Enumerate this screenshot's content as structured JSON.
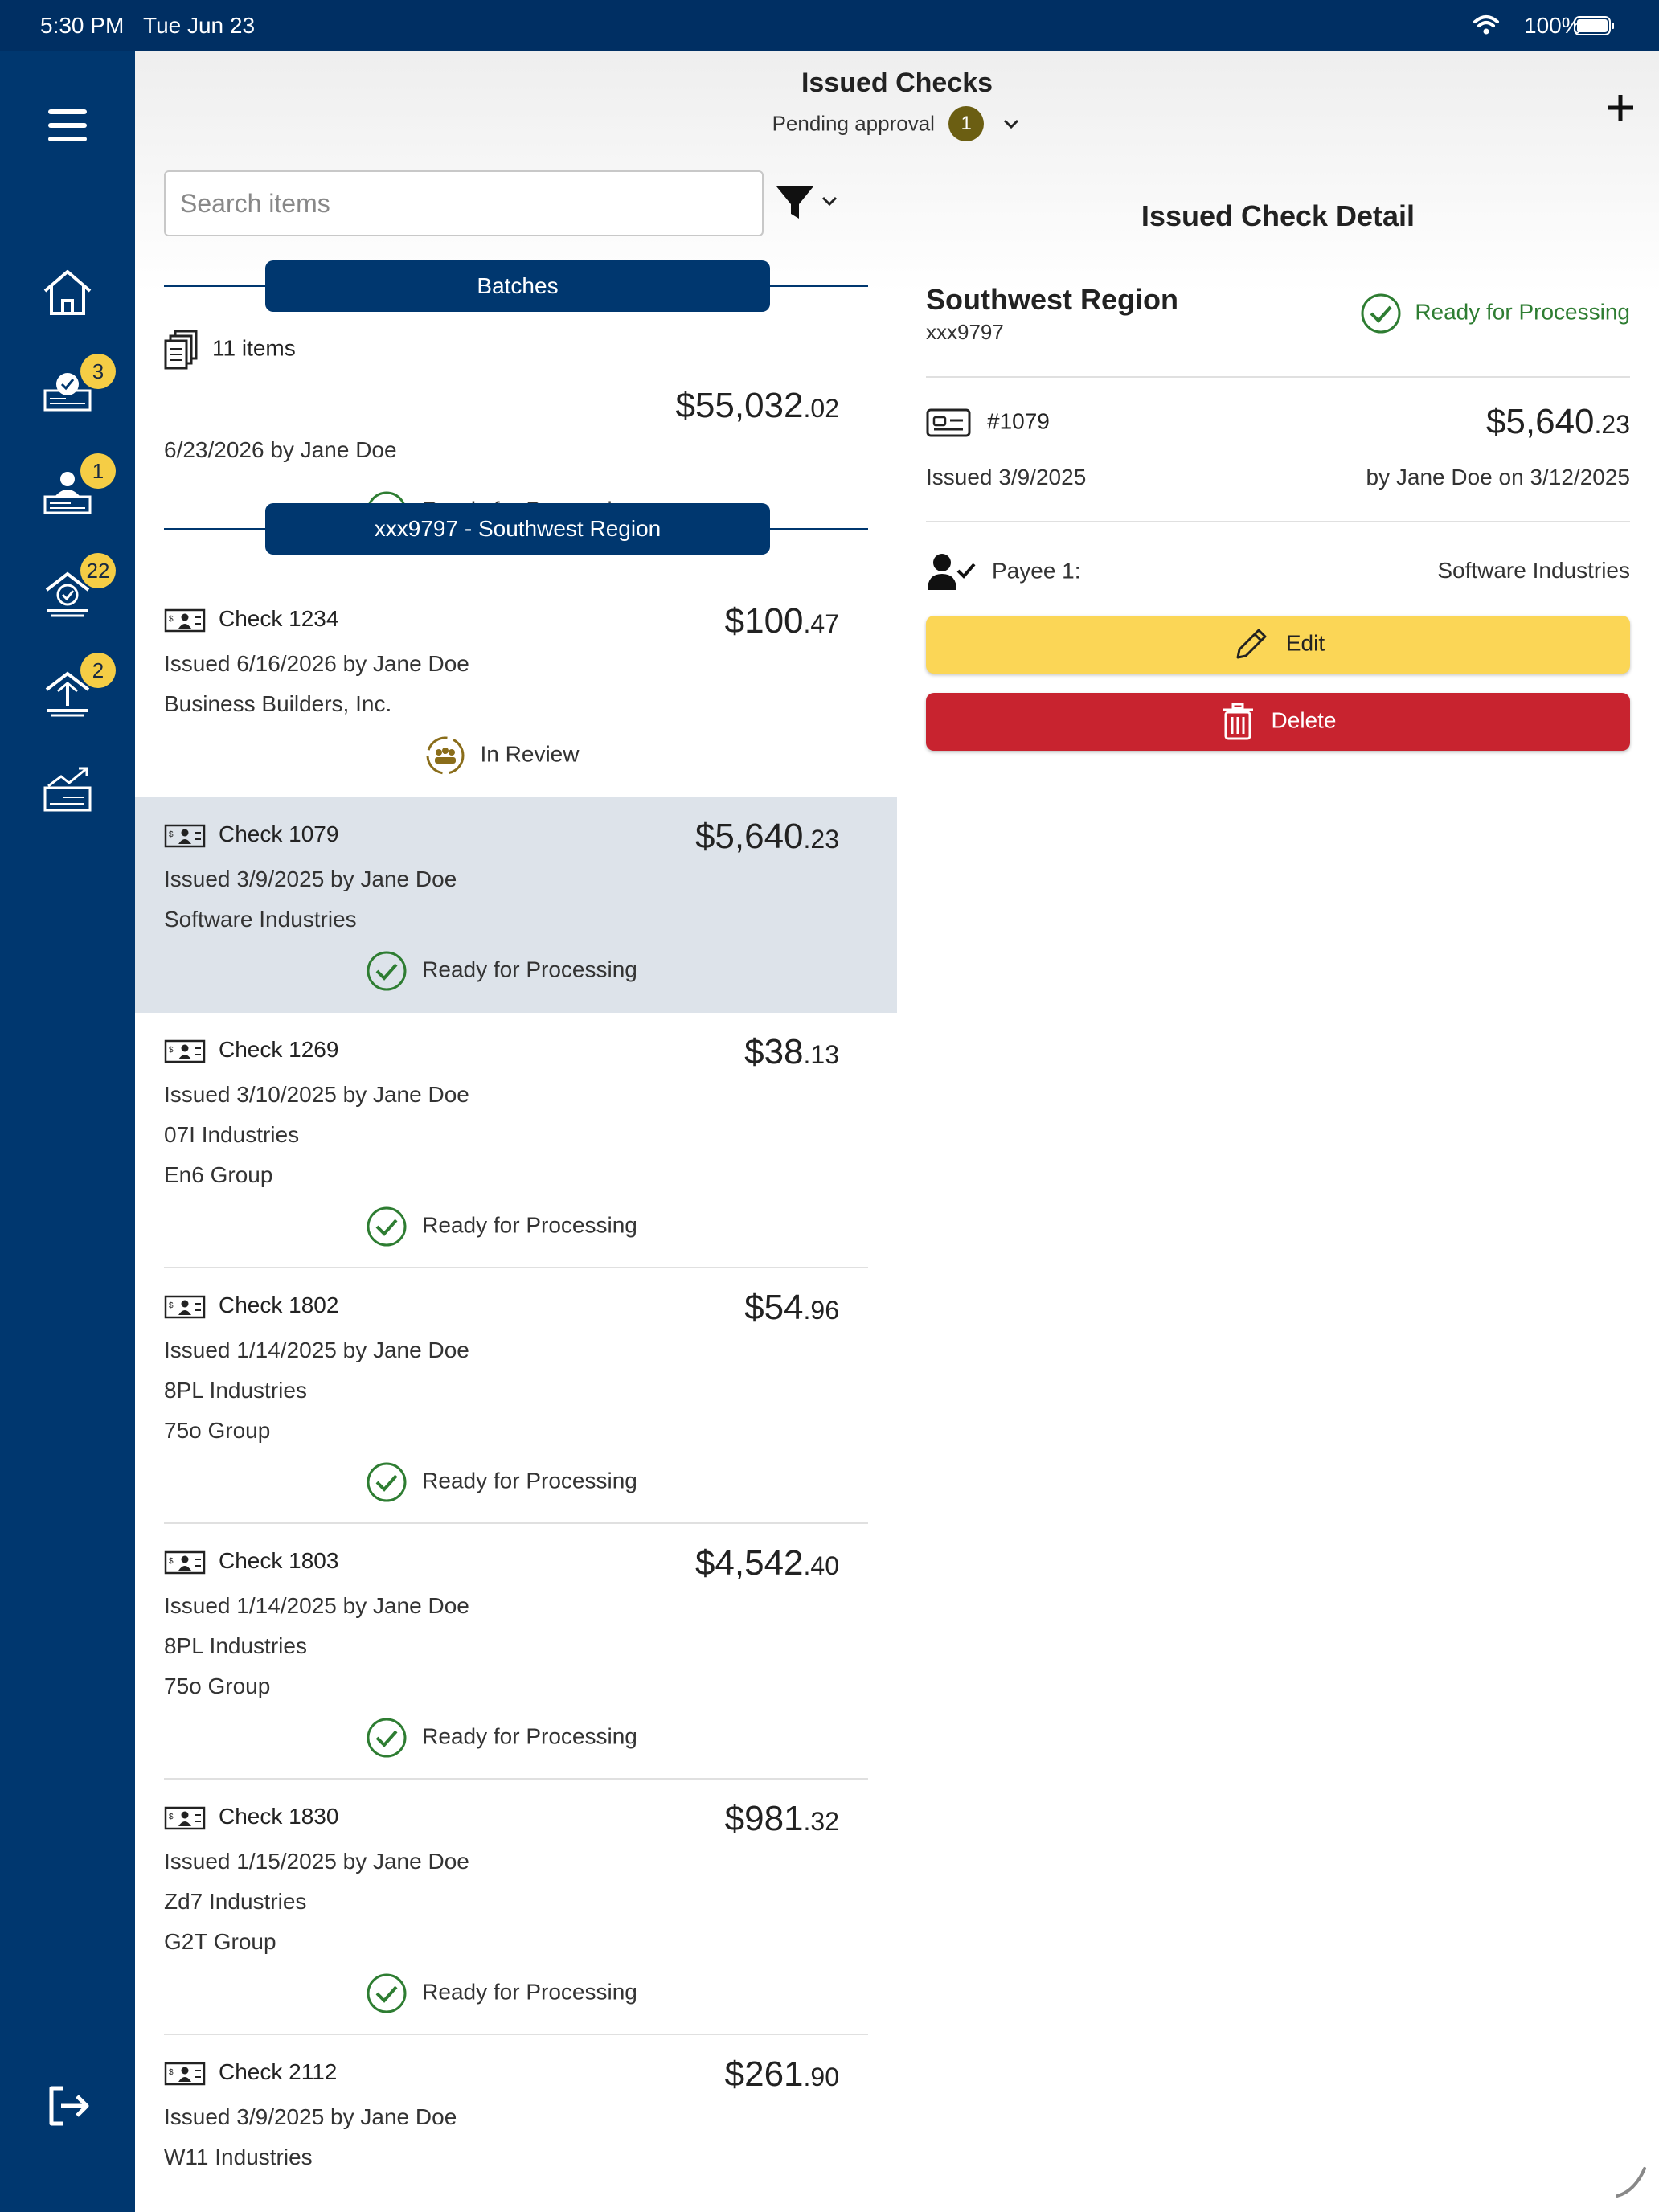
{
  "status_bar": {
    "time": "5:30 PM",
    "date": "Tue Jun 23",
    "battery": "100%"
  },
  "sidebar": {
    "items": [
      {
        "name": "home",
        "icon": "home-icon",
        "badge": null
      },
      {
        "name": "approve-checks",
        "icon": "check-approval-icon",
        "badge": "3"
      },
      {
        "name": "approve-payees",
        "icon": "payee-approval-icon",
        "badge": "1"
      },
      {
        "name": "approve-deposits",
        "icon": "deposit-approval-icon",
        "badge": "22"
      },
      {
        "name": "approve-transfers",
        "icon": "transfer-approval-icon",
        "badge": "2"
      },
      {
        "name": "reports",
        "icon": "chart-check-icon",
        "badge": null
      }
    ],
    "logout_icon": "logout-icon"
  },
  "header": {
    "title": "Issued Checks",
    "subtitle": "Pending approval",
    "pending_count": "1",
    "add_icon": "plus-icon"
  },
  "search": {
    "placeholder": "Search items",
    "value": ""
  },
  "batches_header": "Batches",
  "batch": {
    "items_label": "11 items",
    "amount_main": "$55,032",
    "amount_cents": ".02",
    "date_by": "6/23/2026 by Jane Doe",
    "status": "Ready for Processing"
  },
  "region_header": "xxx9797 - Southwest Region",
  "checks": [
    {
      "title": "Check 1234",
      "amount_main": "$100",
      "amount_cents": ".47",
      "issued": "Issued 6/16/2026 by Jane Doe",
      "payees": [
        "Business Builders, Inc."
      ],
      "status": "In Review",
      "status_type": "review"
    },
    {
      "title": "Check 1079",
      "amount_main": "$5,640",
      "amount_cents": ".23",
      "issued": "Issued 3/9/2025 by Jane Doe",
      "payees": [
        "Software Industries"
      ],
      "status": "Ready for Processing",
      "status_type": "ready",
      "selected": true
    },
    {
      "title": "Check 1269",
      "amount_main": "$38",
      "amount_cents": ".13",
      "issued": "Issued 3/10/2025 by Jane Doe",
      "payees": [
        "07I Industries",
        "En6 Group"
      ],
      "status": "Ready for Processing",
      "status_type": "ready"
    },
    {
      "title": "Check 1802",
      "amount_main": "$54",
      "amount_cents": ".96",
      "issued": "Issued 1/14/2025 by Jane Doe",
      "payees": [
        "8PL Industries",
        "75o Group"
      ],
      "status": "Ready for Processing",
      "status_type": "ready"
    },
    {
      "title": "Check 1803",
      "amount_main": "$4,542",
      "amount_cents": ".40",
      "issued": "Issued 1/14/2025 by Jane Doe",
      "payees": [
        "8PL Industries",
        "75o Group"
      ],
      "status": "Ready for Processing",
      "status_type": "ready"
    },
    {
      "title": "Check 1830",
      "amount_main": "$981",
      "amount_cents": ".32",
      "issued": "Issued 1/15/2025 by Jane Doe",
      "payees": [
        "Zd7 Industries",
        "G2T Group"
      ],
      "status": "Ready for Processing",
      "status_type": "ready"
    },
    {
      "title": "Check 2112",
      "amount_main": "$261",
      "amount_cents": ".90",
      "issued": "Issued 3/9/2025 by Jane Doe",
      "payees": [
        "W11 Industries"
      ],
      "status": "",
      "status_type": "none"
    }
  ],
  "detail": {
    "heading": "Issued Check Detail",
    "region_name": "Southwest Region",
    "account": "xxx9797",
    "status": "Ready for Processing",
    "check_number": "#1079",
    "amount_main": "$5,640",
    "amount_cents": ".23",
    "issued": "Issued 3/9/2025",
    "by": "by Jane Doe on 3/12/2025",
    "payee_label": "Payee 1:",
    "payee_value": "Software Industries",
    "edit_label": "Edit",
    "delete_label": "Delete"
  },
  "colors": {
    "navy": "#00376f",
    "status_green": "#2e7d32",
    "edit_yellow": "#fbd656",
    "delete_red": "#c8232f",
    "badge_yellow": "#f5cd45",
    "selected_row": "#dde3ea"
  }
}
